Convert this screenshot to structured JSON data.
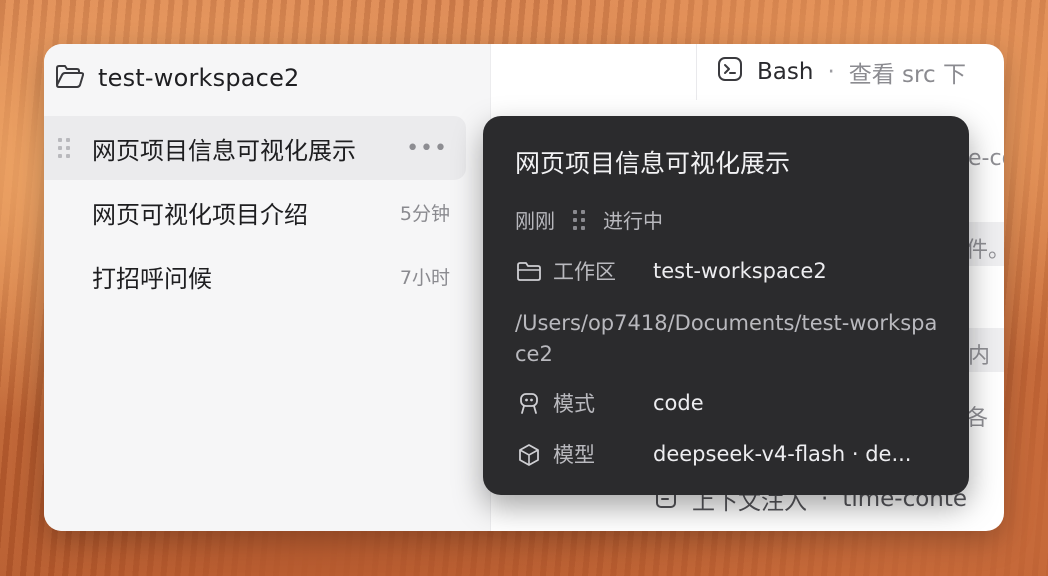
{
  "sidebar": {
    "workspace_name": "test-workspace2",
    "items": [
      {
        "label": "网页项目信息可视化展示",
        "time": "",
        "more": "•••"
      },
      {
        "label": "网页可视化项目介绍",
        "time": "5分钟"
      },
      {
        "label": "打招呼问候",
        "time": "7小时"
      }
    ]
  },
  "right_panel": {
    "tab": {
      "label": "Bash",
      "separator": "·",
      "detail": "查看 src 下"
    },
    "bg_lines": [
      "e-conte",
      "件。",
      "内",
      "各",
      "上下文注入",
      "time-conte"
    ],
    "bottom": {
      "label": "上下文注入",
      "separator": "·",
      "detail": "time-conte"
    }
  },
  "tooltip": {
    "title": "网页项目信息可视化展示",
    "time": "刚刚",
    "status": "进行中",
    "workspace_key": "工作区",
    "workspace_value": "test-workspace2",
    "path": "/Users/op7418/Documents/test-workspace2",
    "mode_key": "模式",
    "mode_value": "code",
    "model_key": "模型",
    "model_value": "deepseek-v4-flash · de..."
  },
  "icons": {
    "workspace": "folder-open-icon",
    "tab": "terminal-icon",
    "tooltip_workspace": "folder-icon",
    "tooltip_mode": "robot-icon",
    "tooltip_model": "cube-icon",
    "bottom": "document-icon"
  }
}
